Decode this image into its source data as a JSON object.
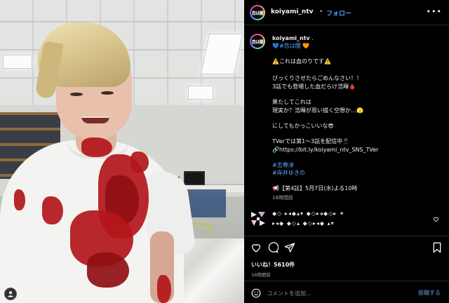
{
  "post": {
    "username": "koiyami_ntv",
    "separator": "•",
    "follow_label": "フォロー",
    "more_label": "•••",
    "avatar_text": "恋は闇"
  },
  "caption": {
    "username": "koiyami_ntv",
    "username_suffix": ".",
    "lines": [
      {
        "text": "💙#恋は闇 🧡",
        "kind": "tag"
      },
      {
        "text": "⚠️これは血のりです⚠️",
        "kind": "text"
      },
      {
        "text": "びっくりさせたらごめんなさい！！",
        "kind": "text"
      },
      {
        "text": "3話でも登場した血だらけ浩暉🩸",
        "kind": "text"
      },
      {
        "text": "果たしてこれは",
        "kind": "text"
      },
      {
        "text": "現実か？浩暉が思い描く空想か…🫣",
        "kind": "text"
      },
      {
        "text": "にしてもかっこいいな😎",
        "kind": "text"
      },
      {
        "text": "TVerでは第1〜3話を配信中📱",
        "kind": "text"
      },
      {
        "text": "🔗https://bit.ly/koiyami_ntv_SNS_TVer",
        "kind": "text"
      },
      {
        "text": "#志尊淳",
        "kind": "tag"
      },
      {
        "text": "#岸井ゆきの",
        "kind": "tag"
      },
      {
        "text": "📢【第4話】5月7日(水)よる10時",
        "kind": "text"
      },
      {
        "text": "16時間前",
        "kind": "meta"
      }
    ]
  },
  "comment": {
    "decoration_line1": "◆◇ ▸◂◆▴▾ ◆◇▸◂◆◇▸ ✦",
    "decoration_line2": "▸◂◆ ◆◇▴ ◆◇▸◂◆ ▴▾",
    "time": "16時間前"
  },
  "stats": {
    "likes": "いいね！5610件",
    "time": "16時間前"
  },
  "composer": {
    "placeholder": "コメントを追加...",
    "post_label": "投稿する"
  },
  "colors": {
    "accent": "#4aa3ff",
    "background": "#000000",
    "text": "#f5f5f5",
    "muted": "#a8a8a8"
  },
  "icons": {
    "like": "heart-icon",
    "comment": "comment-icon",
    "share": "send-icon",
    "save": "bookmark-icon",
    "emoji": "emoji-icon",
    "user": "user-icon"
  }
}
